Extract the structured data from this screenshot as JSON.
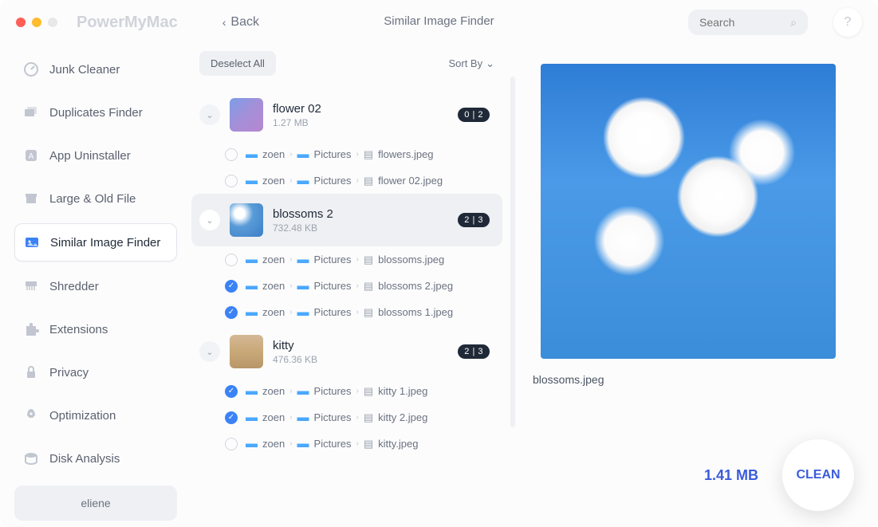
{
  "app_name": "PowerMyMac",
  "back_label": "Back",
  "page_title": "Similar Image Finder",
  "search_placeholder": "Search",
  "sidebar": {
    "items": [
      {
        "label": "Junk Cleaner"
      },
      {
        "label": "Duplicates Finder"
      },
      {
        "label": "App Uninstaller"
      },
      {
        "label": "Large & Old File"
      },
      {
        "label": "Similar Image Finder"
      },
      {
        "label": "Shredder"
      },
      {
        "label": "Extensions"
      },
      {
        "label": "Privacy"
      },
      {
        "label": "Optimization"
      },
      {
        "label": "Disk Analysis"
      }
    ],
    "user": "eliene"
  },
  "list": {
    "deselect_label": "Deselect All",
    "sortby_label": "Sort By",
    "groups": [
      {
        "name": "flower 02",
        "size": "1.27 MB",
        "badge": "0 | 2",
        "files": [
          {
            "checked": false,
            "path": [
              "zoen",
              "Pictures"
            ],
            "filename": "flowers.jpeg"
          },
          {
            "checked": false,
            "path": [
              "zoen",
              "Pictures"
            ],
            "filename": "flower 02.jpeg"
          }
        ]
      },
      {
        "name": "blossoms 2",
        "size": "732.48 KB",
        "badge": "2 | 3",
        "files": [
          {
            "checked": false,
            "path": [
              "zoen",
              "Pictures"
            ],
            "filename": "blossoms.jpeg"
          },
          {
            "checked": true,
            "path": [
              "zoen",
              "Pictures"
            ],
            "filename": "blossoms 2.jpeg"
          },
          {
            "checked": true,
            "path": [
              "zoen",
              "Pictures"
            ],
            "filename": "blossoms 1.jpeg"
          }
        ]
      },
      {
        "name": "kitty",
        "size": "476.36 KB",
        "badge": "2 | 3",
        "files": [
          {
            "checked": true,
            "path": [
              "zoen",
              "Pictures"
            ],
            "filename": "kitty 1.jpeg"
          },
          {
            "checked": true,
            "path": [
              "zoen",
              "Pictures"
            ],
            "filename": "kitty 2.jpeg"
          },
          {
            "checked": false,
            "path": [
              "zoen",
              "Pictures"
            ],
            "filename": "kitty.jpeg"
          }
        ]
      }
    ]
  },
  "preview": {
    "filename": "blossoms.jpeg"
  },
  "footer": {
    "total_size": "1.41 MB",
    "clean_label": "CLEAN"
  }
}
